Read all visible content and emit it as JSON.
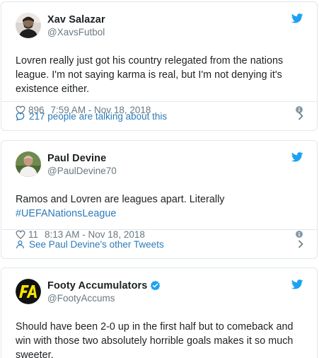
{
  "tweets": [
    {
      "display_name": "Xav Salazar",
      "screen_name": "@XavsFutbol",
      "verified": false,
      "text_lines": [
        "Lovren really just got his country relegated from the nations",
        "league. I'm not saying karma is real, but I'm not denying it's",
        "existence either."
      ],
      "likes": "896",
      "timestamp": "7:59 AM - Nov 18, 2018",
      "footer_label": "217 people are talking about this",
      "footer_icon": "speech-bubble-icon"
    },
    {
      "display_name": "Paul Devine",
      "screen_name": "@PaulDevine70",
      "verified": false,
      "text_lines": [
        "Ramos and Lovren are leagues apart. Literally"
      ],
      "hashtag": "#UEFANationsLeague",
      "likes": "11",
      "timestamp": "8:13 AM - Nov 18, 2018",
      "footer_label": "See Paul Devine's other Tweets",
      "footer_icon": "person-icon"
    },
    {
      "display_name": "Footy Accumulators",
      "screen_name": "@FootyAccums",
      "verified": true,
      "text_lines": [
        "Should have been 2-0 up in the first half but to comeback and",
        "win with those two absolutely horrible goals makes it so much",
        "sweeter."
      ],
      "avatar_logo_text": "FA"
    }
  ],
  "colors": {
    "text": "#1c2022",
    "secondary": "#697882",
    "link": "#2b7bb9",
    "twitter_blue": "#1da1f2",
    "border": "#e1e8ed"
  }
}
